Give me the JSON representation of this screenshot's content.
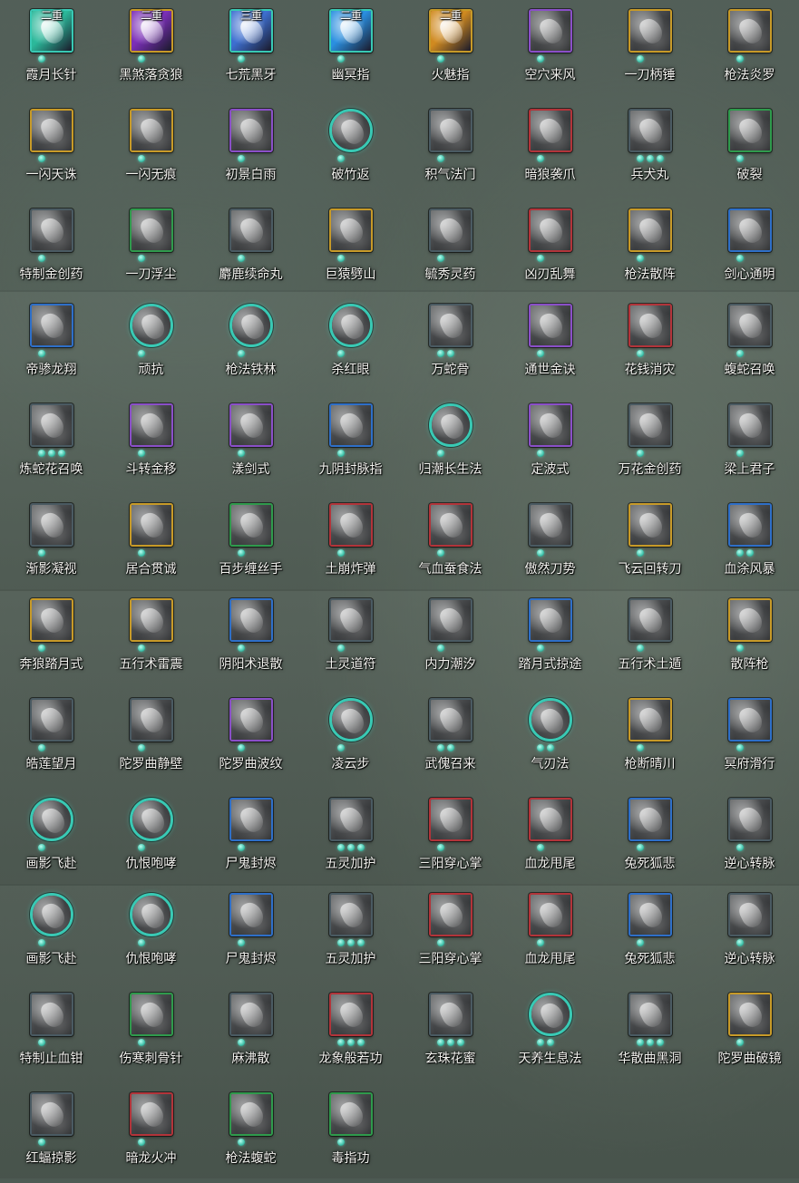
{
  "colors": {
    "frame": {
      "green": "#2f9a4c",
      "gold": "#c79a28",
      "purple": "#8a4fc8",
      "blue": "#2e6fc8",
      "red": "#b2343a",
      "teal": "#39c9b4",
      "gray": "#4a5a62"
    },
    "dot": "#3fc2aa"
  },
  "skills": [
    {
      "name": "霞月长针",
      "frame": "teal",
      "shape": "square",
      "dots": 1,
      "tag": "二重",
      "art": "#2bb89a"
    },
    {
      "name": "黑煞落贪狼",
      "frame": "gold",
      "shape": "square",
      "dots": 1,
      "tag": "二重",
      "art": "#7b2fb8"
    },
    {
      "name": "七荒黑牙",
      "frame": "teal",
      "shape": "square",
      "dots": 1,
      "tag": "三重",
      "art": "#3d6fd0"
    },
    {
      "name": "幽冥指",
      "frame": "teal",
      "shape": "square",
      "dots": 1,
      "tag": "二重",
      "art": "#2a8fe0"
    },
    {
      "name": "火魅指",
      "frame": "gold",
      "shape": "square",
      "dots": 1,
      "tag": "二重",
      "art": "#d08a20"
    },
    {
      "name": "空穴来风",
      "frame": "purple",
      "shape": "square",
      "dots": 1,
      "tag": "",
      "art": ""
    },
    {
      "name": "一刀柄锤",
      "frame": "gold",
      "shape": "square",
      "dots": 1,
      "tag": "",
      "art": ""
    },
    {
      "name": "枪法炎罗",
      "frame": "gold",
      "shape": "square",
      "dots": 1,
      "tag": "",
      "art": ""
    },
    {
      "name": "一闪天诛",
      "frame": "gold",
      "shape": "square",
      "dots": 1,
      "tag": "",
      "art": ""
    },
    {
      "name": "一闪无痕",
      "frame": "gold",
      "shape": "square",
      "dots": 1,
      "tag": "",
      "art": ""
    },
    {
      "name": "初景白雨",
      "frame": "purple",
      "shape": "square",
      "dots": 1,
      "tag": "",
      "art": ""
    },
    {
      "name": "破竹返",
      "frame": "teal",
      "shape": "round",
      "dots": 1,
      "tag": "",
      "art": ""
    },
    {
      "name": "积气法门",
      "frame": "gray",
      "shape": "square",
      "dots": 1,
      "tag": "",
      "art": ""
    },
    {
      "name": "暗狼袭爪",
      "frame": "red",
      "shape": "square",
      "dots": 1,
      "tag": "",
      "art": ""
    },
    {
      "name": "兵犬丸",
      "frame": "gray",
      "shape": "square",
      "dots": 3,
      "tag": "",
      "art": ""
    },
    {
      "name": "破裂",
      "frame": "green",
      "shape": "square",
      "dots": 1,
      "tag": "",
      "art": ""
    },
    {
      "name": "特制金创药",
      "frame": "gray",
      "shape": "square",
      "dots": 1,
      "tag": "",
      "art": ""
    },
    {
      "name": "一刀浮尘",
      "frame": "green",
      "shape": "square",
      "dots": 1,
      "tag": "",
      "art": ""
    },
    {
      "name": "麝鹿续命丸",
      "frame": "gray",
      "shape": "square",
      "dots": 1,
      "tag": "",
      "art": ""
    },
    {
      "name": "巨猿劈山",
      "frame": "gold",
      "shape": "square",
      "dots": 1,
      "tag": "",
      "art": ""
    },
    {
      "name": "毓秀灵药",
      "frame": "gray",
      "shape": "square",
      "dots": 1,
      "tag": "",
      "art": ""
    },
    {
      "name": "凶刃乱舞",
      "frame": "red",
      "shape": "square",
      "dots": 1,
      "tag": "",
      "art": ""
    },
    {
      "name": "枪法散阵",
      "frame": "gold",
      "shape": "square",
      "dots": 1,
      "tag": "",
      "art": ""
    },
    {
      "name": "剑心通明",
      "frame": "blue",
      "shape": "square",
      "dots": 1,
      "tag": "",
      "art": ""
    },
    {
      "name": "帝骖龙翔",
      "frame": "blue",
      "shape": "square",
      "dots": 1,
      "tag": "",
      "art": ""
    },
    {
      "name": "顽抗",
      "frame": "teal",
      "shape": "round",
      "dots": 1,
      "tag": "",
      "art": ""
    },
    {
      "name": "枪法铁林",
      "frame": "teal",
      "shape": "round",
      "dots": 1,
      "tag": "",
      "art": ""
    },
    {
      "name": "杀红眼",
      "frame": "teal",
      "shape": "round",
      "dots": 1,
      "tag": "",
      "art": ""
    },
    {
      "name": "万蛇骨",
      "frame": "gray",
      "shape": "square",
      "dots": 2,
      "tag": "",
      "art": ""
    },
    {
      "name": "通世金诀",
      "frame": "purple",
      "shape": "square",
      "dots": 1,
      "tag": "",
      "art": ""
    },
    {
      "name": "花钱消灾",
      "frame": "red",
      "shape": "square",
      "dots": 1,
      "tag": "",
      "art": ""
    },
    {
      "name": "蝮蛇召唤",
      "frame": "gray",
      "shape": "square",
      "dots": 1,
      "tag": "",
      "art": ""
    },
    {
      "name": "炼蛇花召唤",
      "frame": "gray",
      "shape": "square",
      "dots": 3,
      "tag": "",
      "art": ""
    },
    {
      "name": "斗转金移",
      "frame": "purple",
      "shape": "square",
      "dots": 1,
      "tag": "",
      "art": ""
    },
    {
      "name": "漾剑式",
      "frame": "purple",
      "shape": "square",
      "dots": 1,
      "tag": "",
      "art": ""
    },
    {
      "name": "九阴封脉指",
      "frame": "blue",
      "shape": "square",
      "dots": 1,
      "tag": "",
      "art": ""
    },
    {
      "name": "归潮长生法",
      "frame": "teal",
      "shape": "round",
      "dots": 1,
      "tag": "",
      "art": ""
    },
    {
      "name": "定波式",
      "frame": "purple",
      "shape": "square",
      "dots": 1,
      "tag": "",
      "art": ""
    },
    {
      "name": "万花金创药",
      "frame": "gray",
      "shape": "square",
      "dots": 1,
      "tag": "",
      "art": ""
    },
    {
      "name": "梁上君子",
      "frame": "gray",
      "shape": "square",
      "dots": 1,
      "tag": "",
      "art": ""
    },
    {
      "name": "渐影凝视",
      "frame": "gray",
      "shape": "square",
      "dots": 1,
      "tag": "",
      "art": ""
    },
    {
      "name": "居合贯诚",
      "frame": "gold",
      "shape": "square",
      "dots": 1,
      "tag": "",
      "art": ""
    },
    {
      "name": "百步缠丝手",
      "frame": "green",
      "shape": "square",
      "dots": 1,
      "tag": "",
      "art": ""
    },
    {
      "name": "土崩炸弹",
      "frame": "red",
      "shape": "square",
      "dots": 1,
      "tag": "",
      "art": ""
    },
    {
      "name": "气血蚕食法",
      "frame": "red",
      "shape": "square",
      "dots": 1,
      "tag": "",
      "art": ""
    },
    {
      "name": "傲然刀势",
      "frame": "gray",
      "shape": "square",
      "dots": 1,
      "tag": "",
      "art": ""
    },
    {
      "name": "飞云回转刀",
      "frame": "gold",
      "shape": "square",
      "dots": 1,
      "tag": "",
      "art": ""
    },
    {
      "name": "血涂风暴",
      "frame": "blue",
      "shape": "square",
      "dots": 2,
      "tag": "",
      "art": ""
    },
    {
      "name": "奔狼踏月式",
      "frame": "gold",
      "shape": "square",
      "dots": 1,
      "tag": "",
      "art": ""
    },
    {
      "name": "五行术雷震",
      "frame": "gold",
      "shape": "square",
      "dots": 1,
      "tag": "",
      "art": ""
    },
    {
      "name": "阴阳术退散",
      "frame": "blue",
      "shape": "square",
      "dots": 1,
      "tag": "",
      "art": ""
    },
    {
      "name": "土灵道符",
      "frame": "gray",
      "shape": "square",
      "dots": 1,
      "tag": "",
      "art": ""
    },
    {
      "name": "内力潮汐",
      "frame": "gray",
      "shape": "square",
      "dots": 1,
      "tag": "",
      "art": ""
    },
    {
      "name": "踏月式掠途",
      "frame": "blue",
      "shape": "square",
      "dots": 1,
      "tag": "",
      "art": ""
    },
    {
      "name": "五行术土遁",
      "frame": "gray",
      "shape": "square",
      "dots": 1,
      "tag": "",
      "art": ""
    },
    {
      "name": "散阵枪",
      "frame": "gold",
      "shape": "square",
      "dots": 1,
      "tag": "",
      "art": ""
    },
    {
      "name": "皓莲望月",
      "frame": "gray",
      "shape": "square",
      "dots": 1,
      "tag": "",
      "art": ""
    },
    {
      "name": "陀罗曲静壁",
      "frame": "gray",
      "shape": "square",
      "dots": 1,
      "tag": "",
      "art": ""
    },
    {
      "name": "陀罗曲波纹",
      "frame": "purple",
      "shape": "square",
      "dots": 1,
      "tag": "",
      "art": ""
    },
    {
      "name": "凌云步",
      "frame": "teal",
      "shape": "round",
      "dots": 1,
      "tag": "",
      "art": ""
    },
    {
      "name": "武傀召来",
      "frame": "gray",
      "shape": "square",
      "dots": 2,
      "tag": "",
      "art": ""
    },
    {
      "name": "气刃法",
      "frame": "teal",
      "shape": "round",
      "dots": 2,
      "tag": "",
      "art": ""
    },
    {
      "name": "枪断晴川",
      "frame": "gold",
      "shape": "square",
      "dots": 1,
      "tag": "",
      "art": ""
    },
    {
      "name": "冥府滑行",
      "frame": "blue",
      "shape": "square",
      "dots": 1,
      "tag": "",
      "art": ""
    },
    {
      "name": "画影飞赴",
      "frame": "teal",
      "shape": "round",
      "dots": 1,
      "tag": "",
      "art": ""
    },
    {
      "name": "仇恨咆哮",
      "frame": "teal",
      "shape": "round",
      "dots": 1,
      "tag": "",
      "art": ""
    },
    {
      "name": "尸鬼封烬",
      "frame": "blue",
      "shape": "square",
      "dots": 1,
      "tag": "",
      "art": ""
    },
    {
      "name": "五灵加护",
      "frame": "gray",
      "shape": "square",
      "dots": 3,
      "tag": "",
      "art": ""
    },
    {
      "name": "三阳穿心掌",
      "frame": "red",
      "shape": "square",
      "dots": 1,
      "tag": "",
      "art": ""
    },
    {
      "name": "血龙甩尾",
      "frame": "red",
      "shape": "square",
      "dots": 1,
      "tag": "",
      "art": ""
    },
    {
      "name": "兔死狐悲",
      "frame": "blue",
      "shape": "square",
      "dots": 1,
      "tag": "",
      "art": ""
    },
    {
      "name": "逆心转脉",
      "frame": "gray",
      "shape": "square",
      "dots": 1,
      "tag": "",
      "art": ""
    },
    {
      "name": "画影飞赴",
      "frame": "teal",
      "shape": "round",
      "dots": 1,
      "tag": "",
      "art": ""
    },
    {
      "name": "仇恨咆哮",
      "frame": "teal",
      "shape": "round",
      "dots": 1,
      "tag": "",
      "art": ""
    },
    {
      "name": "尸鬼封烬",
      "frame": "blue",
      "shape": "square",
      "dots": 1,
      "tag": "",
      "art": ""
    },
    {
      "name": "五灵加护",
      "frame": "gray",
      "shape": "square",
      "dots": 3,
      "tag": "",
      "art": ""
    },
    {
      "name": "三阳穿心掌",
      "frame": "red",
      "shape": "square",
      "dots": 1,
      "tag": "",
      "art": ""
    },
    {
      "name": "血龙甩尾",
      "frame": "red",
      "shape": "square",
      "dots": 1,
      "tag": "",
      "art": ""
    },
    {
      "name": "兔死狐悲",
      "frame": "blue",
      "shape": "square",
      "dots": 1,
      "tag": "",
      "art": ""
    },
    {
      "name": "逆心转脉",
      "frame": "gray",
      "shape": "square",
      "dots": 1,
      "tag": "",
      "art": ""
    },
    {
      "name": "特制止血钳",
      "frame": "gray",
      "shape": "square",
      "dots": 1,
      "tag": "",
      "art": ""
    },
    {
      "name": "伤寒刺骨针",
      "frame": "green",
      "shape": "square",
      "dots": 1,
      "tag": "",
      "art": ""
    },
    {
      "name": "麻沸散",
      "frame": "gray",
      "shape": "square",
      "dots": 1,
      "tag": "",
      "art": ""
    },
    {
      "name": "龙象般若功",
      "frame": "red",
      "shape": "square",
      "dots": 3,
      "tag": "",
      "art": ""
    },
    {
      "name": "玄珠花蜜",
      "frame": "gray",
      "shape": "square",
      "dots": 3,
      "tag": "",
      "art": ""
    },
    {
      "name": "天养生息法",
      "frame": "teal",
      "shape": "round",
      "dots": 2,
      "tag": "",
      "art": ""
    },
    {
      "name": "华散曲黑洞",
      "frame": "gray",
      "shape": "square",
      "dots": 3,
      "tag": "",
      "art": ""
    },
    {
      "name": "陀罗曲破镜",
      "frame": "gold",
      "shape": "square",
      "dots": 1,
      "tag": "",
      "art": ""
    },
    {
      "name": "红蝠掠影",
      "frame": "gray",
      "shape": "square",
      "dots": 1,
      "tag": "",
      "art": ""
    },
    {
      "name": "暗龙火冲",
      "frame": "red",
      "shape": "square",
      "dots": 1,
      "tag": "",
      "art": ""
    },
    {
      "name": "枪法蝮蛇",
      "frame": "green",
      "shape": "square",
      "dots": 1,
      "tag": "",
      "art": ""
    },
    {
      "name": "毒指功",
      "frame": "green",
      "shape": "square",
      "dots": 1,
      "tag": "",
      "art": ""
    }
  ]
}
